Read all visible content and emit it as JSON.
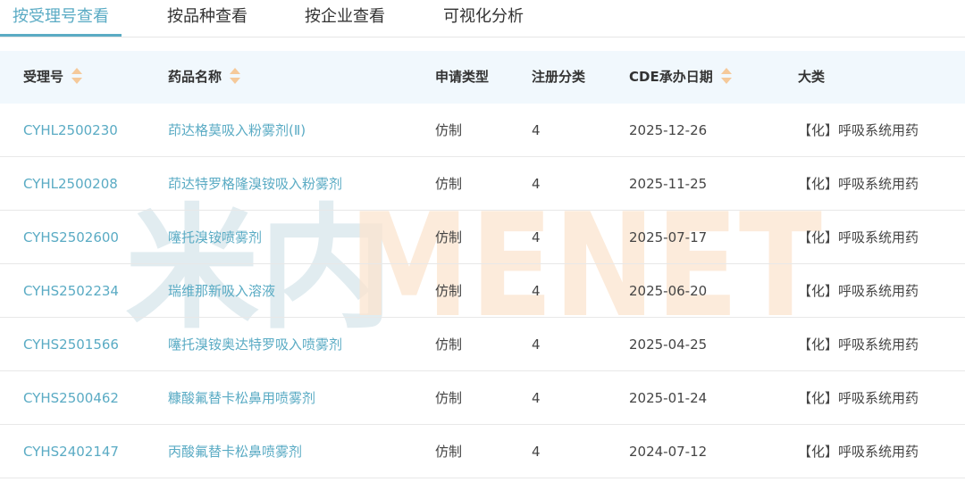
{
  "tabs": [
    {
      "label": "按受理号查看",
      "active": true
    },
    {
      "label": "按品种查看",
      "active": false
    },
    {
      "label": "按企业查看",
      "active": false
    },
    {
      "label": "可视化分析",
      "active": false
    }
  ],
  "table": {
    "headers": [
      {
        "label": "受理号",
        "sortable": true
      },
      {
        "label": "药品名称",
        "sortable": true
      },
      {
        "label": "申请类型",
        "sortable": false
      },
      {
        "label": "注册分类",
        "sortable": false
      },
      {
        "label": "CDE承办日期",
        "sortable": true
      },
      {
        "label": "大类",
        "sortable": false
      }
    ],
    "rows": [
      {
        "id": "CYHL2500230",
        "name": "茚达格莫吸入粉雾剂(Ⅱ)",
        "type": "仿制",
        "class": "4",
        "date": "2025-12-26",
        "category": "【化】呼吸系统用药"
      },
      {
        "id": "CYHL2500208",
        "name": "茚达特罗格隆溴铵吸入粉雾剂",
        "type": "仿制",
        "class": "4",
        "date": "2025-11-25",
        "category": "【化】呼吸系统用药"
      },
      {
        "id": "CYHS2502600",
        "name": "噻托溴铵喷雾剂",
        "type": "仿制",
        "class": "4",
        "date": "2025-07-17",
        "category": "【化】呼吸系统用药"
      },
      {
        "id": "CYHS2502234",
        "name": "瑞维那新吸入溶液",
        "type": "仿制",
        "class": "4",
        "date": "2025-06-20",
        "category": "【化】呼吸系统用药"
      },
      {
        "id": "CYHS2501566",
        "name": "噻托溴铵奥达特罗吸入喷雾剂",
        "type": "仿制",
        "class": "4",
        "date": "2025-04-25",
        "category": "【化】呼吸系统用药"
      },
      {
        "id": "CYHS2500462",
        "name": "糠酸氟替卡松鼻用喷雾剂",
        "type": "仿制",
        "class": "4",
        "date": "2025-01-24",
        "category": "【化】呼吸系统用药"
      },
      {
        "id": "CYHS2402147",
        "name": "丙酸氟替卡松鼻喷雾剂",
        "type": "仿制",
        "class": "4",
        "date": "2024-07-12",
        "category": "【化】呼吸系统用药"
      }
    ]
  },
  "watermark": {
    "cn": "米内",
    "en": "MENET"
  },
  "colors": {
    "accent": "#5aabc4",
    "header_bg": "#f1f8fd",
    "sort_icon": "#f5c99a",
    "watermark_cn": "#d7e6ec",
    "watermark_en": "#fce5cf"
  }
}
